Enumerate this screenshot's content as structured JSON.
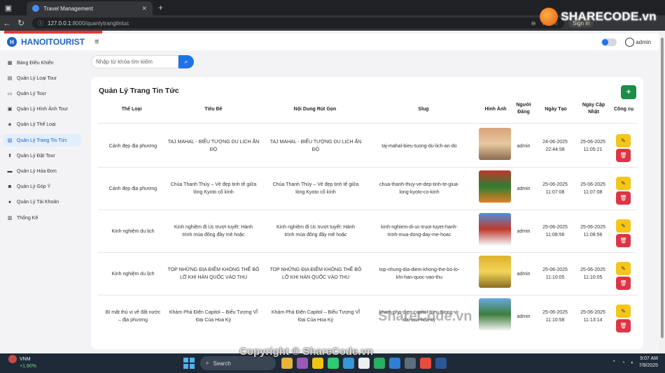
{
  "browser": {
    "tab_title": "Travel Management",
    "url_host": "127.0.0.1",
    "url_path": ":8000/quanlytrangtintuc",
    "sign_in": "Sign in"
  },
  "brand": {
    "name_a": "SHARE",
    "name_b": "CODE.vn"
  },
  "app": {
    "logo": "HANOITOURIST",
    "user": "admin",
    "search_placeholder": "Nhập từ khóa tìm kiếm"
  },
  "sidebar": {
    "items": [
      {
        "label": "Bảng Điều Khiển",
        "icon": "grid-icon"
      },
      {
        "label": "Quản Lý Loại Tour",
        "icon": "table-icon"
      },
      {
        "label": "Quản Lý Tour",
        "icon": "map-icon"
      },
      {
        "label": "Quản Lý Hình Ảnh Tour",
        "icon": "image-icon"
      },
      {
        "label": "Quản Lý Thể Loại",
        "icon": "tag-icon"
      },
      {
        "label": "Quản Lý Trang Tin Tức",
        "icon": "news-icon"
      },
      {
        "label": "Quản Lý Đặt Tour",
        "icon": "booking-icon"
      },
      {
        "label": "Quản Lý Hóa Đơn",
        "icon": "invoice-icon"
      },
      {
        "label": "Quản Lý Góp Ý",
        "icon": "feedback-icon"
      },
      {
        "label": "Quản Lý Tài Khoản",
        "icon": "user-icon"
      },
      {
        "label": "Thống Kê",
        "icon": "chart-icon"
      }
    ]
  },
  "page": {
    "title": "Quản Lý Trang Tin Tức",
    "columns": {
      "category": "Thể Loại",
      "title": "Tiêu Đề",
      "summary": "Nội Dung Rút Gọn",
      "slug": "Slug",
      "image": "Hình Ảnh",
      "poster_1": "Người",
      "poster_2": "Đăng",
      "created": "Ngày Tạo",
      "updated_1": "Ngày Cập",
      "updated_2": "Nhật",
      "tools": "Công cụ"
    },
    "rows": [
      {
        "category": "Cảnh đẹp địa phương",
        "title_1": "TAJ MAHAL - BIỂU TƯỢNG DU LỊCH ẤN",
        "title_2": "ĐỘ",
        "summary_1": "TAJ MAHAL - BIỂU TƯỢNG DU LỊCH ẤN",
        "summary_2": "ĐỘ",
        "slug_1": "taj-mahal-bieu-tuong-du-lich-an-do",
        "slug_2": "",
        "poster": "admin",
        "created_1": "24-06-2025",
        "created_2": "22:44:58",
        "updated_1": "25-06-2025",
        "updated_2": "11:05:21",
        "img_colors": [
          "#d9a37a",
          "#8c6b4d",
          "#e8c7a0"
        ]
      },
      {
        "category": "Cảnh đẹp địa phương",
        "title_1": "Chùa Thanh Thủy – Vẻ đẹp tinh tế giữa",
        "title_2": "lòng Kyoto cổ kính",
        "summary_1": "Chùa Thanh Thủy – Vẻ đẹp tinh tế giữa",
        "summary_2": "lòng Kyoto cổ kính",
        "slug_1": "chua-thanh-thuy-ve-dep-tinh-te-giua-",
        "slug_2": "long-kyoto-co-kinh",
        "poster": "admin",
        "created_1": "25-06-2025",
        "created_2": "11:07:08",
        "updated_1": "25-06-2025",
        "updated_2": "11:07:08",
        "img_colors": [
          "#c0392b",
          "#e67e22",
          "#2e7d32"
        ]
      },
      {
        "category": "Kinh nghiệm du lịch",
        "title_1": "Kinh nghiệm đi Úc trượt tuyết: Hành",
        "title_2": "trình mùa đông đầy mê hoặc",
        "summary_1": "Kinh nghiệm đi Úc trượt tuyết: Hành",
        "summary_2": "trình mùa đông đầy mê hoặc",
        "slug_1": "kinh-nghiem-di-uc-truot-tuyet-hanh-",
        "slug_2": "trinh-mua-dong-day-me-hoac",
        "poster": "admin",
        "created_1": "25-06-2025",
        "created_2": "11:08:56",
        "updated_1": "25-06-2025",
        "updated_2": "11:08:56",
        "img_colors": [
          "#4f8fd9",
          "#f4f6f9",
          "#c0392b"
        ]
      },
      {
        "category": "Kinh nghiệm du lịch",
        "title_1": "TOP NHỮNG ĐỊA ĐIỂM KHÔNG THỂ BỎ",
        "title_2": "LỠ KHI HÀN QUỐC VÀO THU",
        "summary_1": "TOP NHỮNG ĐỊA ĐIỂM KHÔNG THỂ BỎ",
        "summary_2": "LỠ KHI HÀN QUỐC VÀO THU",
        "slug_1": "top-nhung-dia-diem-khong-the-bo-lo-",
        "slug_2": "khi-han-quoc-vao-thu",
        "poster": "admin",
        "created_1": "25-06-2025",
        "created_2": "11:10:05",
        "updated_1": "25-06-2025",
        "updated_2": "11:10:05",
        "img_colors": [
          "#e0b12a",
          "#8a6d1f",
          "#f2d55a"
        ]
      },
      {
        "category": "Bí mật thú vị về đất nước",
        "category_2": "– địa phương",
        "title_1": "Khám Phá Điện Capitol – Biểu Tượng VĨ",
        "title_2": "Đại Của Hoa Kỳ",
        "summary_1": "Khám Phá Điện Capitol – Biểu Tượng VĨ",
        "summary_2": "Đại Của Hoa Kỳ",
        "slug_1": "kham-pha-dien-capitol-bieu-tuong-vi-",
        "slug_2": "dai-cua-hoa-ky",
        "poster": "admin",
        "created_1": "25-06-2025",
        "created_2": "11:10:58",
        "updated_1": "25-06-2025",
        "updated_2": "11:13:14",
        "img_colors": [
          "#6aa9e0",
          "#f2f2f2",
          "#3c7d3c"
        ]
      }
    ]
  },
  "watermark": "ShareCode.vn",
  "copyright": "Copyright © ShareCode.vn",
  "taskbar": {
    "ticker": "VNM",
    "ticker_change": "+1.90%",
    "search": "Search",
    "time": "9:07 AM",
    "date": "7/9/2025"
  }
}
